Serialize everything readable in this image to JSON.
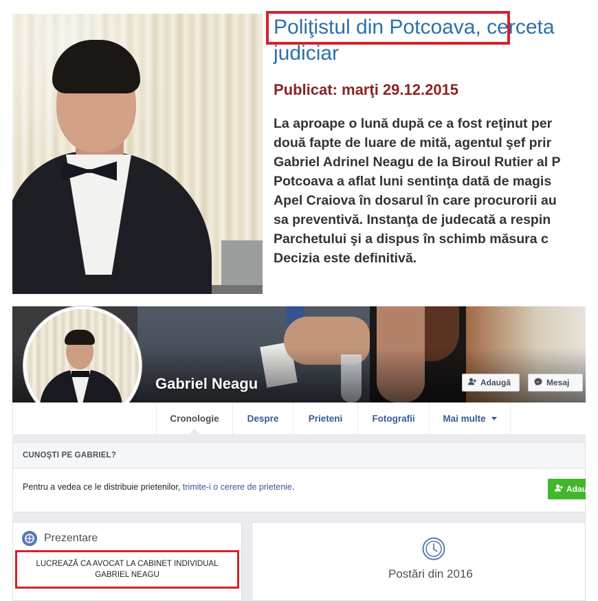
{
  "article": {
    "title_line1": "Poliţistul din Potcoava, cerceta",
    "title_line2": "judiciar",
    "published": "Publicat: marţi 29.12.2015",
    "body_lines": [
      "La aproape o lună după ce a fost reţinut per",
      "două fapte de luare de mită, agentul şef prir",
      "Gabriel Adrinel Neagu de la Biroul Rutier al P",
      "Potcoava a aflat luni sentinţa dată de magis",
      "Apel Craiova în dosarul în care procurorii au",
      "sa preventivă. Instanţa de judecată a respin",
      "Parchetului şi a dispus în schimb măsura c",
      "Decizia este definitivă."
    ]
  },
  "profile": {
    "name": "Gabriel Neagu",
    "add_friend_label": "Adaugă",
    "message_label": "Mesaj"
  },
  "nav": {
    "tabs": [
      "Cronologie",
      "Despre",
      "Prieteni",
      "Fotografii",
      "Mai multe"
    ]
  },
  "know": {
    "title": "CUNOŞTI PE GABRIEL?",
    "text": "Pentru a vedea ce le distribuie prietenilor, ",
    "link": "trimite-i o cerere de prietenie",
    "text_end": ".",
    "button": "Adaugă"
  },
  "intro": {
    "title": "Prezentare",
    "work_line1": "LUCREAZĂ CA AVOCAT LA CABINET INDIVIDUAL",
    "work_line2": "GABRIEL NEAGU"
  },
  "posts": {
    "label": "Postări din 2016"
  },
  "colors": {
    "highlight": "#d81f2a",
    "title_blue": "#2c70a8",
    "published_red": "#8a2424",
    "fb_link": "#365899",
    "fb_green": "#42b72a"
  }
}
